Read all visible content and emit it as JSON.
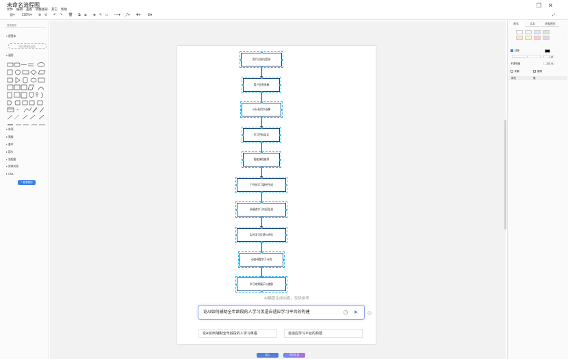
{
  "app": {
    "title": "未命名流程图",
    "menu": [
      "文件",
      "编辑",
      "查看",
      "调整图形",
      "其它",
      "帮助"
    ]
  },
  "toolbar": {
    "zoom": "110%"
  },
  "sidebar": {
    "search_placeholder": "搜索图形",
    "scratchpad_label": "便笺本",
    "scratchpad_hint": "把元素拖至此处",
    "general_label": "通用",
    "sections": [
      "杂项",
      "高级",
      "基本",
      "箭头",
      "流程图",
      "实体关系",
      "UML"
    ],
    "more_shapes": "+ 更多图形"
  },
  "diagram": {
    "nodes": [
      "用户注册与登录",
      "用户信息采集",
      "AI分析用户画像",
      "学习目标设定",
      "智能课程推荐",
      "个性化学习路径生成",
      "多模态学习内容呈现",
      "实时学习反馈与评估",
      "动态调整学习计划",
      "学习成果展示与激励"
    ]
  },
  "format_panel": {
    "tabs": [
      "样式",
      "文本",
      "调整图形"
    ],
    "fill_label": "填充",
    "line_label": "线条",
    "line_width": "1 pt",
    "opacity_label": "不透明度",
    "opacity_value": "100 %",
    "shadow_label": "阴影",
    "rounded_label": "圆角",
    "property_label": "属性",
    "value_label": "值",
    "colors": {
      "swatches": [
        "#ffffff",
        "#f5f5f5",
        "#dae8fc",
        "#d5e8d4",
        "#ffe6cc",
        "#fff2cc",
        "#f8cecc",
        "#e1d5e7"
      ],
      "line_color": "#000000",
      "accent": "#3d7ee6"
    }
  },
  "ai": {
    "disclaimer": "AI模型生成内容，仅供参考",
    "prompt": "论AI如何辅助全年龄段的人学习英语自适应学习平台的构建",
    "suggestions": [
      "论AI如何辅助全年龄段的人学习英语",
      "自适应学习平台的构建"
    ]
  },
  "bottom_buttons": {
    "insert": "插入",
    "regenerate": "再次生成"
  }
}
